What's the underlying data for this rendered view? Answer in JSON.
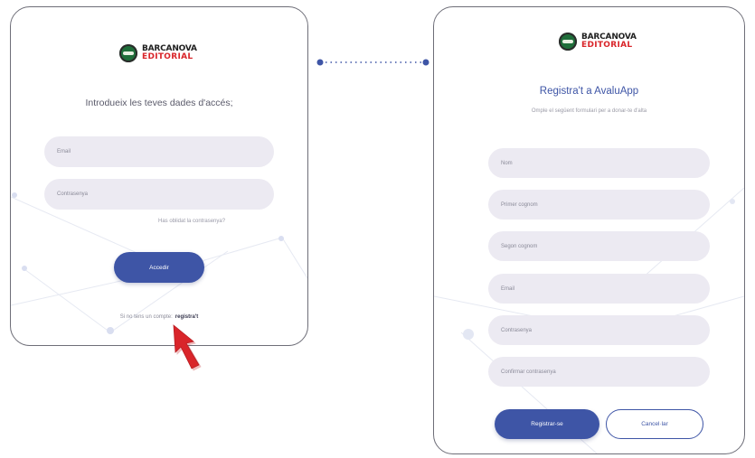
{
  "brand": {
    "line1": "BARCANOVA",
    "line2": "EDITORIAL",
    "colors": {
      "green": "#1f6e3a",
      "red": "#d9252a"
    }
  },
  "login": {
    "heading": "Introdueix les teves dades d'accés;",
    "email_placeholder": "Email",
    "password_placeholder": "Contrasenya",
    "forgot_link": "Has oblidat la contrasenya?",
    "submit_label": "Accedir",
    "signup_prompt": "Si no tens un compte:",
    "signup_link": "registra't"
  },
  "register": {
    "heading": "Registra't a AvaluApp",
    "subheading": "Omple el següent formulari per a donar-te d'alta",
    "fields": [
      {
        "placeholder": "Nom"
      },
      {
        "placeholder": "Primer cognom"
      },
      {
        "placeholder": "Segon cognom"
      },
      {
        "placeholder": "Email"
      },
      {
        "placeholder": "Contrasenya"
      },
      {
        "placeholder": "Confirmar contrasenya"
      }
    ],
    "submit_label": "Registrar-se",
    "cancel_label": "Cancel·lar"
  },
  "colors": {
    "primary": "#3e55a6",
    "field_bg": "#eceaf2",
    "connector": "#3e55a6",
    "arrow": "#d9252a"
  },
  "icons": {
    "logo": "barcanova-logo-icon",
    "pointer": "red-pointer-arrow-icon"
  }
}
